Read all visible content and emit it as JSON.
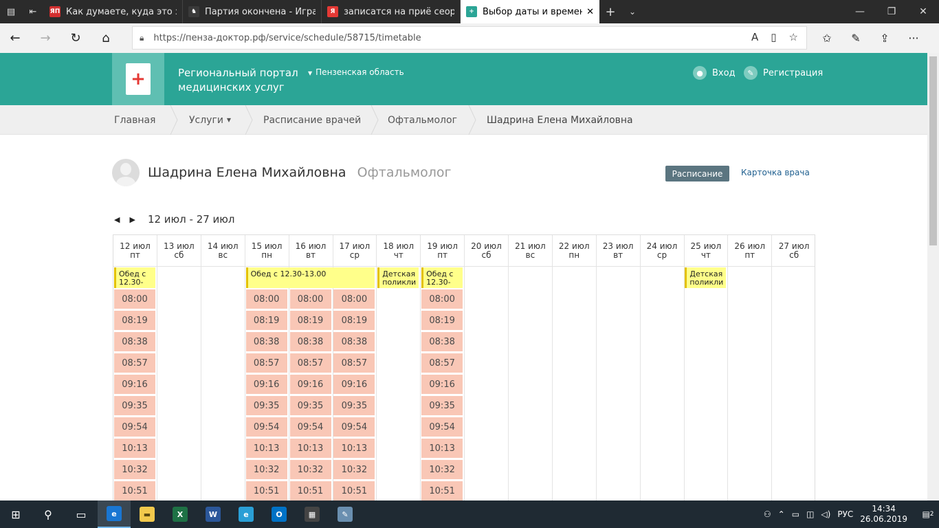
{
  "browser": {
    "tabs": [
      {
        "title": "Как думаете, куда это за оч",
        "favicon_text": "ЯП",
        "favicon_color": "#d32f2f"
      },
      {
        "title": "Партия окончена - Игра в ш",
        "favicon_text": "♞",
        "favicon_color": "#3a3a3a"
      },
      {
        "title": "записатся на приё сеордоп",
        "favicon_text": "Я",
        "favicon_color": "#e53935"
      },
      {
        "title": "Выбор даты и времени",
        "favicon_text": "+",
        "favicon_color": "#2ba596",
        "active": true
      }
    ],
    "url": "https://пенза-доктор.рф/service/schedule/58715/timetable"
  },
  "header": {
    "portal_line1": "Региональный портал",
    "portal_line2": "медицинских услуг",
    "region": "Пензенская область",
    "login": "Вход",
    "register": "Регистрация",
    "accent": "#2ba596"
  },
  "breadcrumbs": [
    "Главная",
    "Услуги",
    "Расписание врачей",
    "Офтальмолог",
    "Шадрина Елена Михайловна"
  ],
  "doctor": {
    "name": "Шадрина Елена Михайловна",
    "specialty": "Офтальмолог",
    "schedule_button": "Расписание",
    "card_link": "Карточка врача"
  },
  "week": {
    "range": "12 июл - 27 июл"
  },
  "days": [
    {
      "date": "12 июл",
      "dow": "пт",
      "has_slots": true
    },
    {
      "date": "13 июл",
      "dow": "сб",
      "has_slots": false
    },
    {
      "date": "14 июл",
      "dow": "вс",
      "has_slots": false
    },
    {
      "date": "15 июл",
      "dow": "пн",
      "has_slots": true
    },
    {
      "date": "16 июл",
      "dow": "вт",
      "has_slots": true
    },
    {
      "date": "17 июл",
      "dow": "ср",
      "has_slots": true
    },
    {
      "date": "18 июл",
      "dow": "чт",
      "has_slots": false
    },
    {
      "date": "19 июл",
      "dow": "пт",
      "has_slots": true
    },
    {
      "date": "20 июл",
      "dow": "сб",
      "has_slots": false
    },
    {
      "date": "21 июл",
      "dow": "вс",
      "has_slots": false
    },
    {
      "date": "22 июл",
      "dow": "пн",
      "has_slots": false
    },
    {
      "date": "23 июл",
      "dow": "вт",
      "has_slots": false
    },
    {
      "date": "24 июл",
      "dow": "ср",
      "has_slots": false
    },
    {
      "date": "25 июл",
      "dow": "чт",
      "has_slots": false
    },
    {
      "date": "26 июл",
      "dow": "пт",
      "has_slots": false
    },
    {
      "date": "27 июл",
      "dow": "сб",
      "has_slots": false
    }
  ],
  "notes": [
    {
      "day_index": 0,
      "span": 1,
      "text": "Обед с\n12.30-"
    },
    {
      "day_index": 3,
      "span": 3,
      "text": "Обед с 12.30-13.00"
    },
    {
      "day_index": 6,
      "span": 1,
      "text": "Детская\nполикли"
    },
    {
      "day_index": 7,
      "span": 1,
      "text": "Обед с\n12.30-"
    },
    {
      "day_index": 13,
      "span": 1,
      "text": "Детская\nполикли"
    }
  ],
  "time_slots": [
    "08:00",
    "08:19",
    "08:38",
    "08:57",
    "09:16",
    "09:35",
    "09:54",
    "10:13",
    "10:32",
    "10:51"
  ],
  "taskbar": {
    "language": "РУС",
    "time": "14:34",
    "date": "26.06.2019",
    "notifications": "2"
  }
}
